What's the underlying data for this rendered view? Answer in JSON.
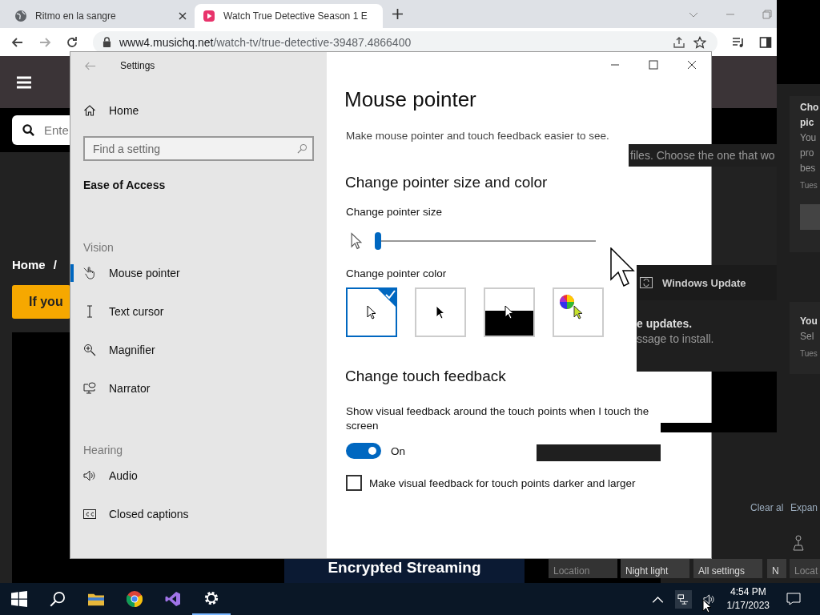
{
  "browser": {
    "tabs": [
      {
        "title": "Ritmo en la sangre",
        "selected": false
      },
      {
        "title": "Watch True Detective Season 1 E",
        "selected": true
      }
    ],
    "url": {
      "host": "www4.musichq.net",
      "path": "/watch-tv/true-detective-39487.4866400"
    }
  },
  "site": {
    "search_placeholder": "Ente",
    "breadcrumb": [
      "Home",
      "/"
    ],
    "banner": "If you",
    "promo": "Encrypted Streaming"
  },
  "settings": {
    "title": "Settings",
    "home": "Home",
    "search_placeholder": "Find a setting",
    "category": "Ease of Access",
    "groups": [
      {
        "heading": "Vision",
        "items": [
          {
            "label": "Mouse pointer",
            "selected": true
          },
          {
            "label": "Text cursor",
            "selected": false
          },
          {
            "label": "Magnifier",
            "selected": false
          },
          {
            "label": "Narrator",
            "selected": false
          }
        ]
      },
      {
        "heading": "Hearing",
        "items": [
          {
            "label": "Audio",
            "selected": false
          },
          {
            "label": "Closed captions",
            "selected": false
          }
        ]
      }
    ],
    "page": {
      "title": "Mouse pointer",
      "description": "Make mouse pointer and touch feedback easier to see.",
      "size_heading": "Change pointer size and color",
      "size_label": "Change pointer size",
      "size_slider": {
        "level": 0.0
      },
      "color_label": "Change pointer color",
      "colors": [
        {
          "kind": "white",
          "selected": true
        },
        {
          "kind": "black",
          "selected": false
        },
        {
          "kind": "inverted",
          "selected": false
        },
        {
          "kind": "custom",
          "selected": false
        }
      ],
      "touch_heading": "Change touch feedback",
      "touch_text": "Show visual feedback around the touch points when I touch the screen",
      "touch_toggle": {
        "on": true,
        "label": "On"
      },
      "darker_checkbox": {
        "checked": false,
        "label": "Make visual feedback for touch points darker and larger"
      }
    }
  },
  "notification_center": {
    "file_hint": "files. Choose the one that wo",
    "update_title": "Windows Update",
    "update_heading": "e updates.",
    "update_body": "ssage to install.",
    "card1": {
      "title_lines": [
        "Cho",
        "pic"
      ],
      "body_lines": [
        "You",
        "pro",
        "bes"
      ],
      "time": "Tues"
    },
    "card2": {
      "title": "You",
      "body": "Sel",
      "time": "Tues"
    },
    "clear_all": "Clear al",
    "expand": "Expan",
    "tiles": [
      {
        "label": "Location",
        "disabled": true
      },
      {
        "label": "Night light",
        "disabled": false
      },
      {
        "label": "All settings",
        "disabled": false
      },
      {
        "label": "N",
        "disabled": false
      },
      {
        "label": "Locat",
        "disabled": true
      }
    ]
  },
  "taskbar": {
    "time": "4:54 PM",
    "date": "1/17/2023"
  }
}
